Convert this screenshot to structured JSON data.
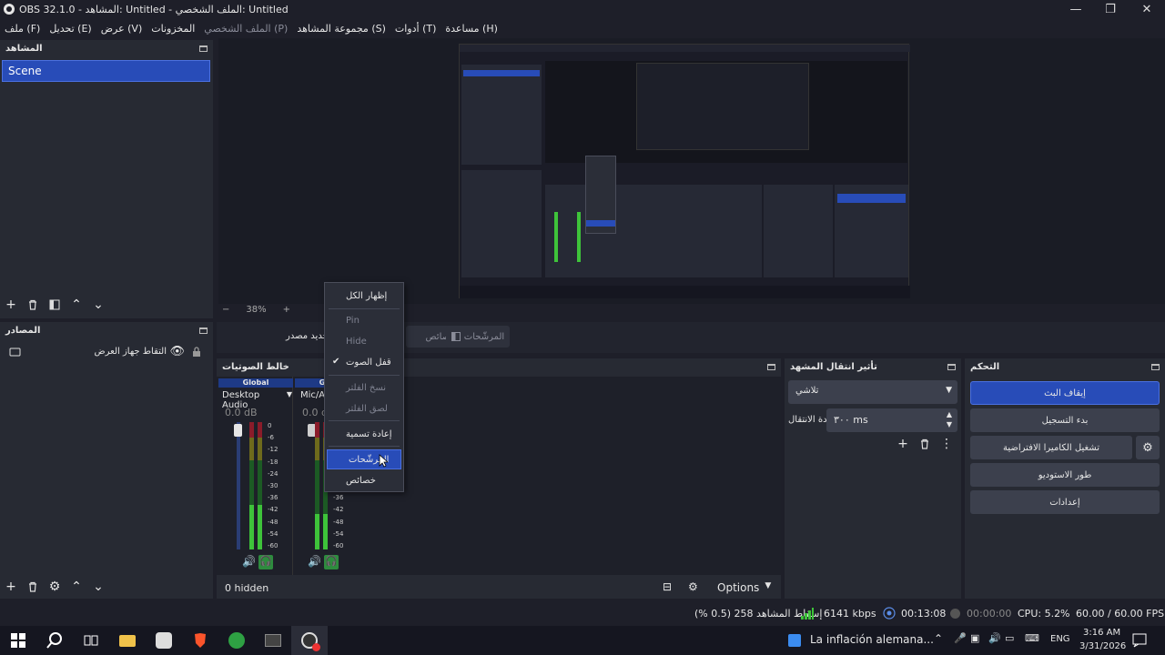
{
  "window": {
    "title": "OBS 32.1.0 - المشاهد: Untitled - الملف الشخصي: Untitled",
    "minimize": "—",
    "maximize": "❐",
    "close": "✕"
  },
  "menu": [
    "ملف (F)",
    "تحديل (E)",
    "عرض (V)",
    "المخزونات",
    "الملف الشخصي (P)",
    "مجموعة المشاهد (S)",
    "أدوات (T)",
    "مساعدة (H)"
  ],
  "scenes": {
    "title": "المشاهد",
    "items": [
      "Scene"
    ]
  },
  "sources": {
    "title": "المصادر",
    "items": [
      {
        "label": "التقاط جهاز العرض",
        "visible": true,
        "locked": true
      }
    ]
  },
  "preview": {
    "zoom": "38%",
    "zoom_minus": "−",
    "zoom_plus": "+"
  },
  "source_toolbar": {
    "no_source": "لم يتم تحديد مصدر",
    "properties": "خصائص",
    "filters": "المرشّحات"
  },
  "audio": {
    "title": "خالط الصوتيات",
    "channels": [
      {
        "group": "Global",
        "name": "Desktop Audio",
        "db": "0.0 dB",
        "level": 0.35
      },
      {
        "group": "Global",
        "name": "Mic/Aux",
        "db": "0.0 dB",
        "level": 0.28
      }
    ],
    "ticks": [
      "0",
      "-6",
      "-12",
      "-18",
      "-24",
      "-30",
      "-36",
      "-42",
      "-48",
      "-54",
      "-60"
    ],
    "hidden": "0 hidden",
    "options": "Options"
  },
  "transitions": {
    "title": "تأثير انتقال المشهد",
    "type": "تلاشي",
    "duration_label": "مدة الانتقال",
    "duration": "٣٠٠ ms"
  },
  "controls": {
    "title": "التحكم",
    "buttons": [
      "إيقاف البث",
      "بدء التسجيل",
      "تشغيل الكاميرا الافتراضية",
      "طور الاستوديو",
      "إعدادات"
    ]
  },
  "context_menu": {
    "items": [
      {
        "label": "إظهار الكل",
        "enabled": true
      },
      {
        "label": "Pin",
        "enabled": false
      },
      {
        "label": "Hide",
        "enabled": false
      },
      {
        "label": "قفل الصوت",
        "enabled": true,
        "checked": true
      },
      {
        "label": "نسخ الفلتر",
        "enabled": false
      },
      {
        "label": "لصق الفلتر",
        "enabled": false
      },
      {
        "label": "إعادة تسمية",
        "enabled": true
      },
      {
        "label": "المرشّحات",
        "enabled": true,
        "highlighted": true
      },
      {
        "label": "خصائص",
        "enabled": true
      }
    ]
  },
  "status": {
    "dropped": "إسقاط المشاهد 258 (0.5 %)",
    "bitrate": "6141 kbps",
    "stream_time": "00:13:08",
    "rec_time": "00:00:00",
    "cpu": "CPU: 5.2%",
    "fps": "60.00 / 60.00 FPS"
  },
  "taskbar": {
    "news": "La inflación alemana...",
    "lang": "ENG",
    "time": "3:16 AM",
    "date": "3/31/2026"
  },
  "colors": {
    "accent": "#284cb8",
    "panel": "#272a33",
    "bg": "#1e1f29",
    "meter_green": "#3ec33a",
    "meter_red": "#8b1c2a"
  }
}
